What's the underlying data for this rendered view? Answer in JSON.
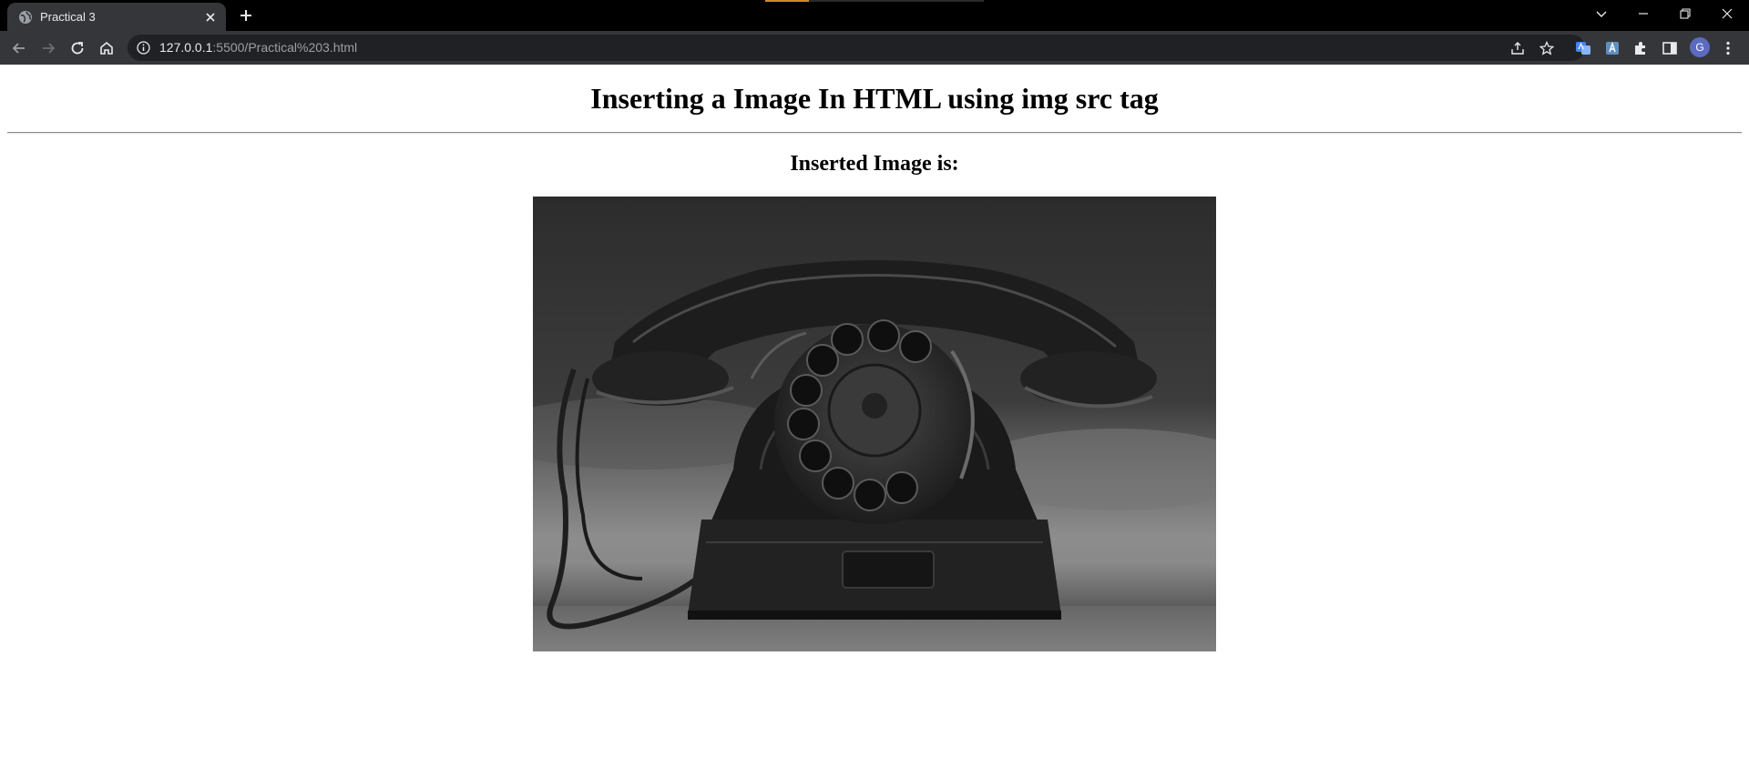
{
  "browser": {
    "tab": {
      "title": "Practical 3",
      "favicon": "globe-icon",
      "close_icon": "close-icon"
    },
    "new_tab_icon": "plus-icon",
    "window_controls": [
      "tab-search-icon",
      "minimize-icon",
      "restore-icon",
      "close-icon"
    ],
    "nav": [
      "back-icon",
      "forward-icon",
      "reload-icon",
      "home-icon"
    ],
    "address": {
      "host": "127.0.0.1",
      "path": ":5500/Practical%203.html"
    },
    "omnibox_actions": [
      "share-icon",
      "bookmark-star-icon"
    ],
    "extensions": [
      "translate-icon",
      "extension-a-icon",
      "puzzle-icon",
      "side-panel-icon"
    ],
    "profile_initial": "G",
    "menu_icon": "kebab-menu-icon"
  },
  "page": {
    "heading": "Inserting a Image In HTML using img src tag",
    "subheading": "Inserted Image is:",
    "image": {
      "subject": "vintage rotary telephone",
      "tone": "black-and-white"
    }
  },
  "colors": {
    "tabbar": "#000000",
    "toolbar": "#35363a",
    "omnibox": "#202124",
    "avatar": "#5c6bc0"
  }
}
